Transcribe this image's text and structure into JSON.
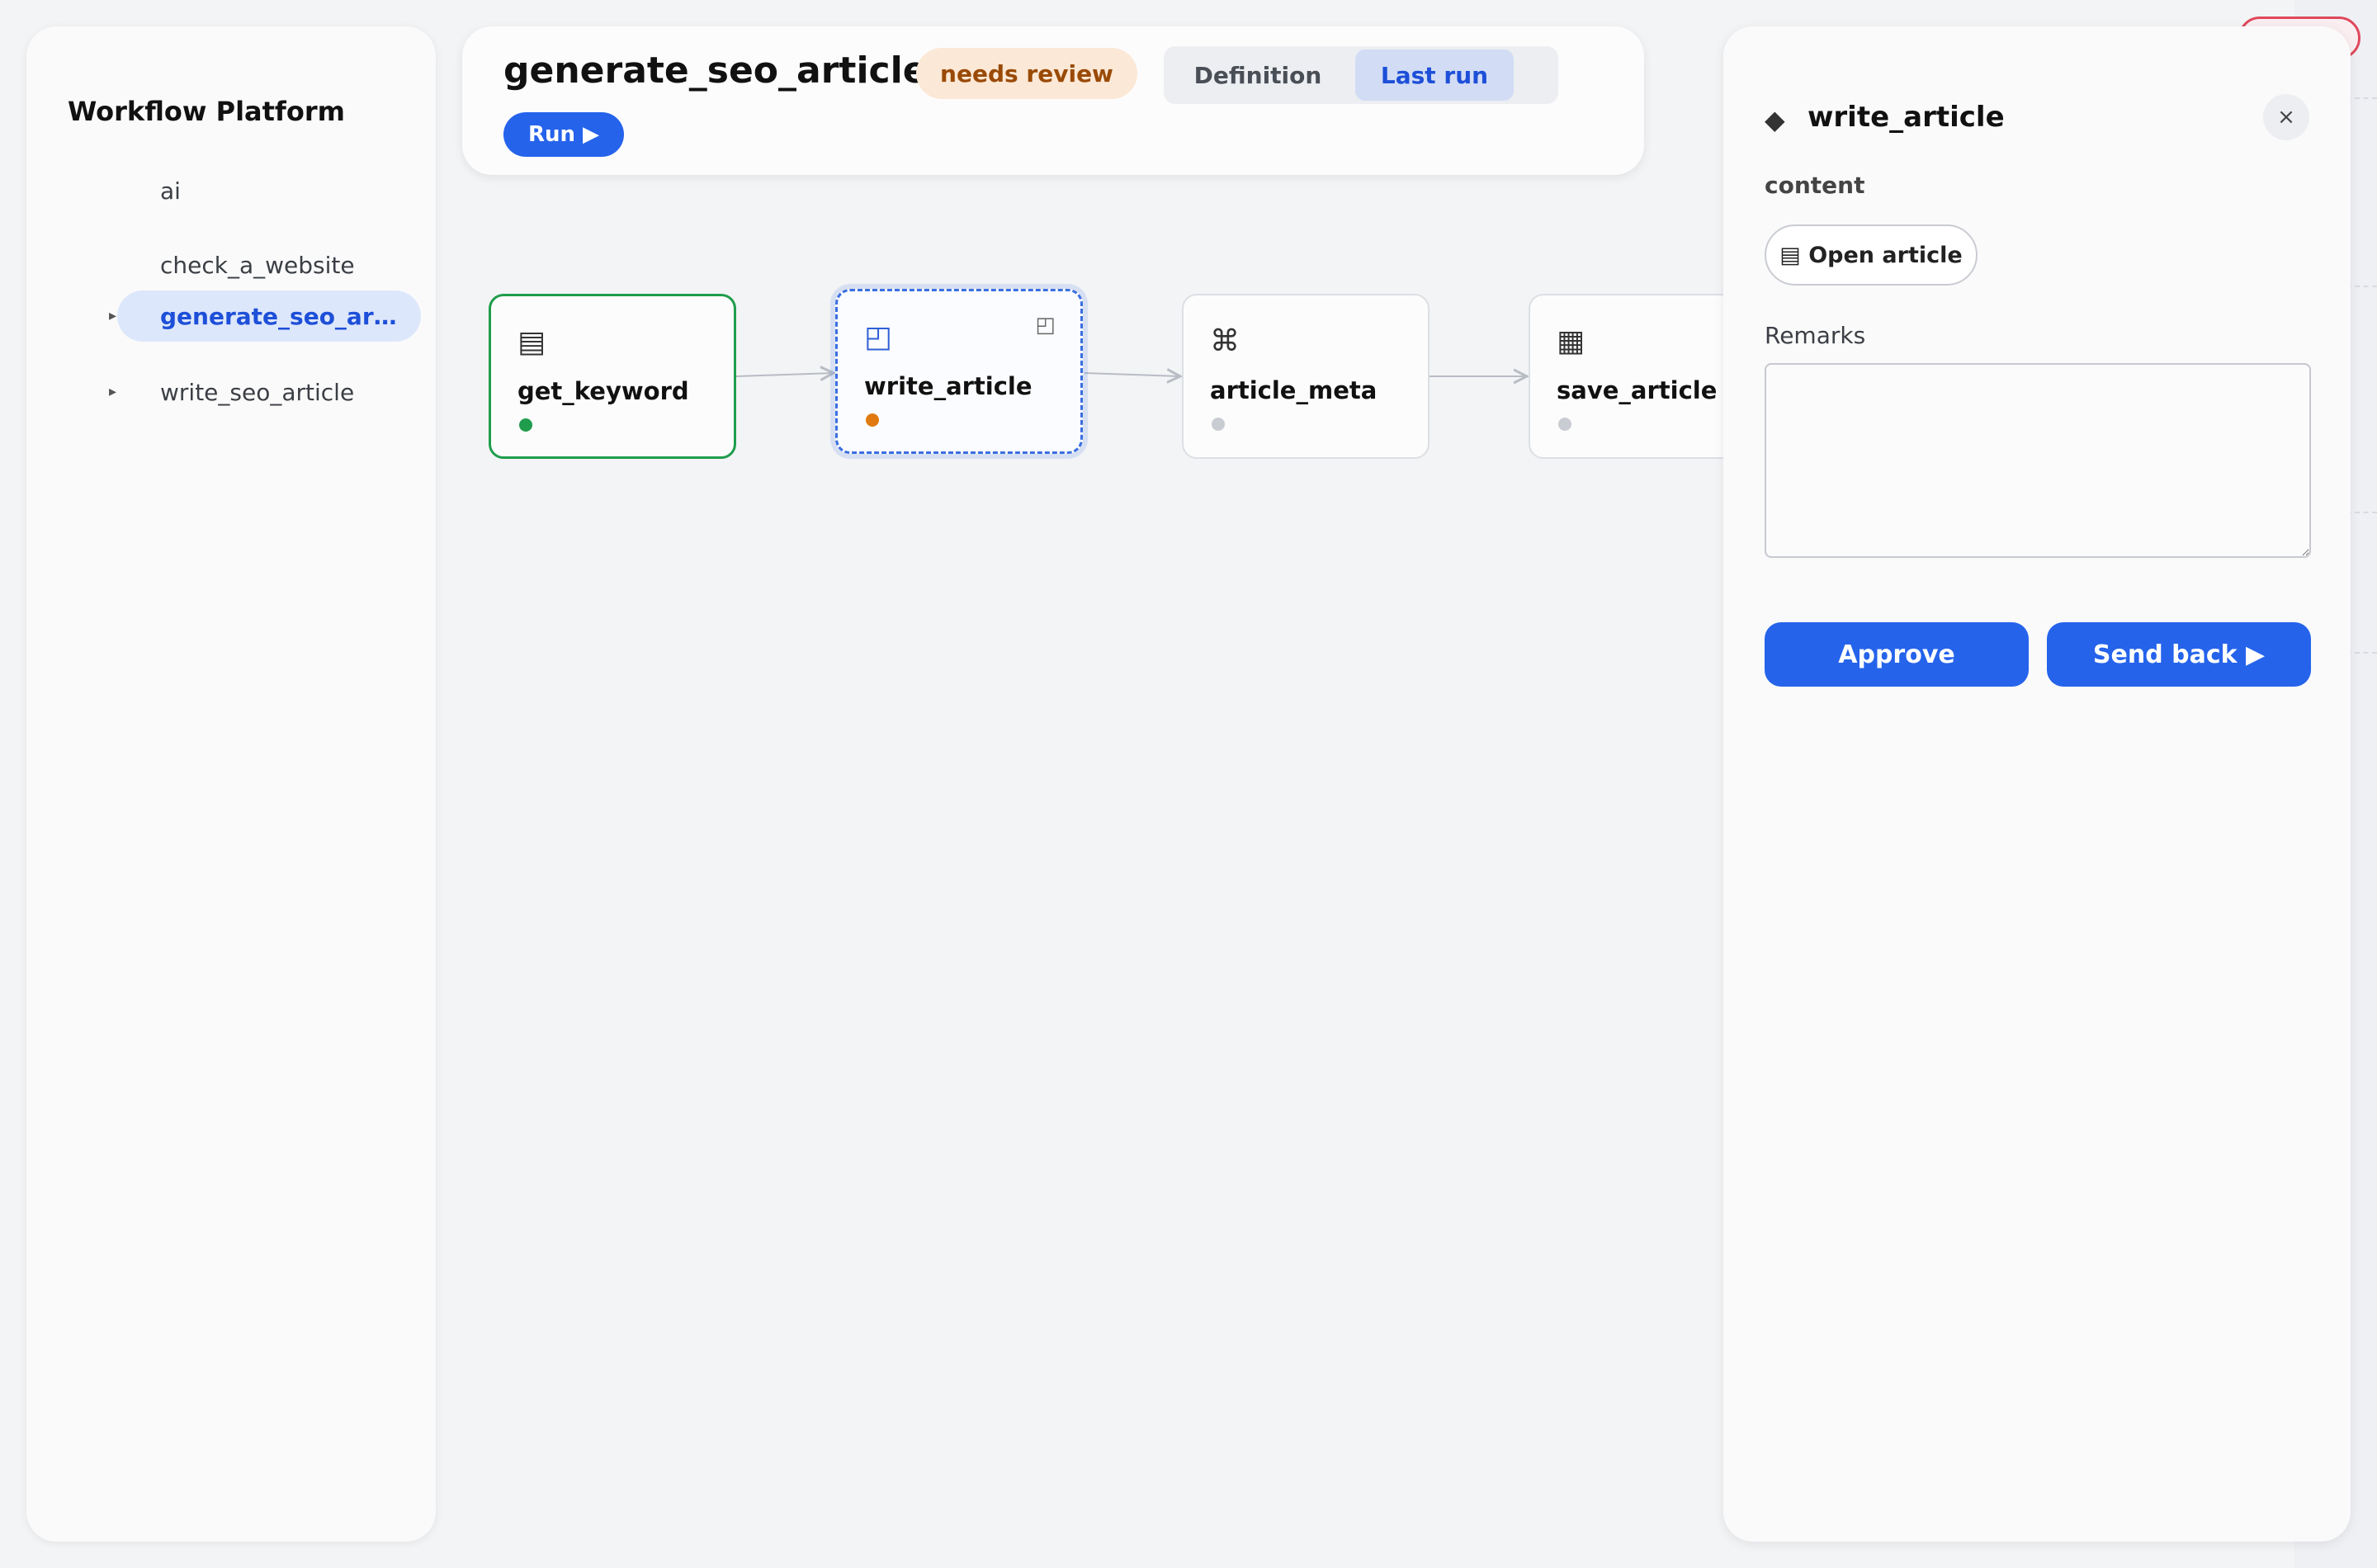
{
  "sidebar": {
    "title": "Workflow Platform",
    "items": [
      {
        "label": "ai",
        "expandable": false,
        "active": false
      },
      {
        "label": "check_a_website",
        "expandable": false,
        "active": false
      },
      {
        "label": "generate_seo_art...",
        "expandable": true,
        "active": true
      },
      {
        "label": "write_seo_article",
        "expandable": true,
        "active": false
      }
    ],
    "caret": "▸"
  },
  "header": {
    "title": "generate_seo_article",
    "status_badge": "needs review",
    "tabs": [
      {
        "label": "Definition",
        "active": false
      },
      {
        "label": "Last run",
        "active": true
      }
    ],
    "run_button": "Run ▶"
  },
  "nodes": [
    {
      "label": "get_keyword",
      "icon": "▤",
      "icon_name": "document-icon",
      "state": "done"
    },
    {
      "label": "write_article",
      "icon": "◰",
      "icon_name": "edit-panel-icon",
      "state": "review",
      "corner_icon": "◰"
    },
    {
      "label": "article_meta",
      "icon": "⌘",
      "icon_name": "command-icon",
      "state": "pending"
    },
    {
      "label": "save_article",
      "icon": "▦",
      "icon_name": "grid-icon",
      "state": "pending"
    }
  ],
  "panel": {
    "node_icon": "◆",
    "title": "write_article",
    "close": "×",
    "section_label": "content",
    "open_article": "▤ Open article",
    "remarks_label": "Remarks",
    "remarks_value": "",
    "approve": "Approve",
    "send_back": "Send back ▶"
  },
  "colors": {
    "accent": "#2563eb",
    "done": "#1f9d4c",
    "review": "#e07a10",
    "pending": "#c9ccd2",
    "badge_bg": "#fbe8d6",
    "badge_text": "#9a4a06"
  }
}
